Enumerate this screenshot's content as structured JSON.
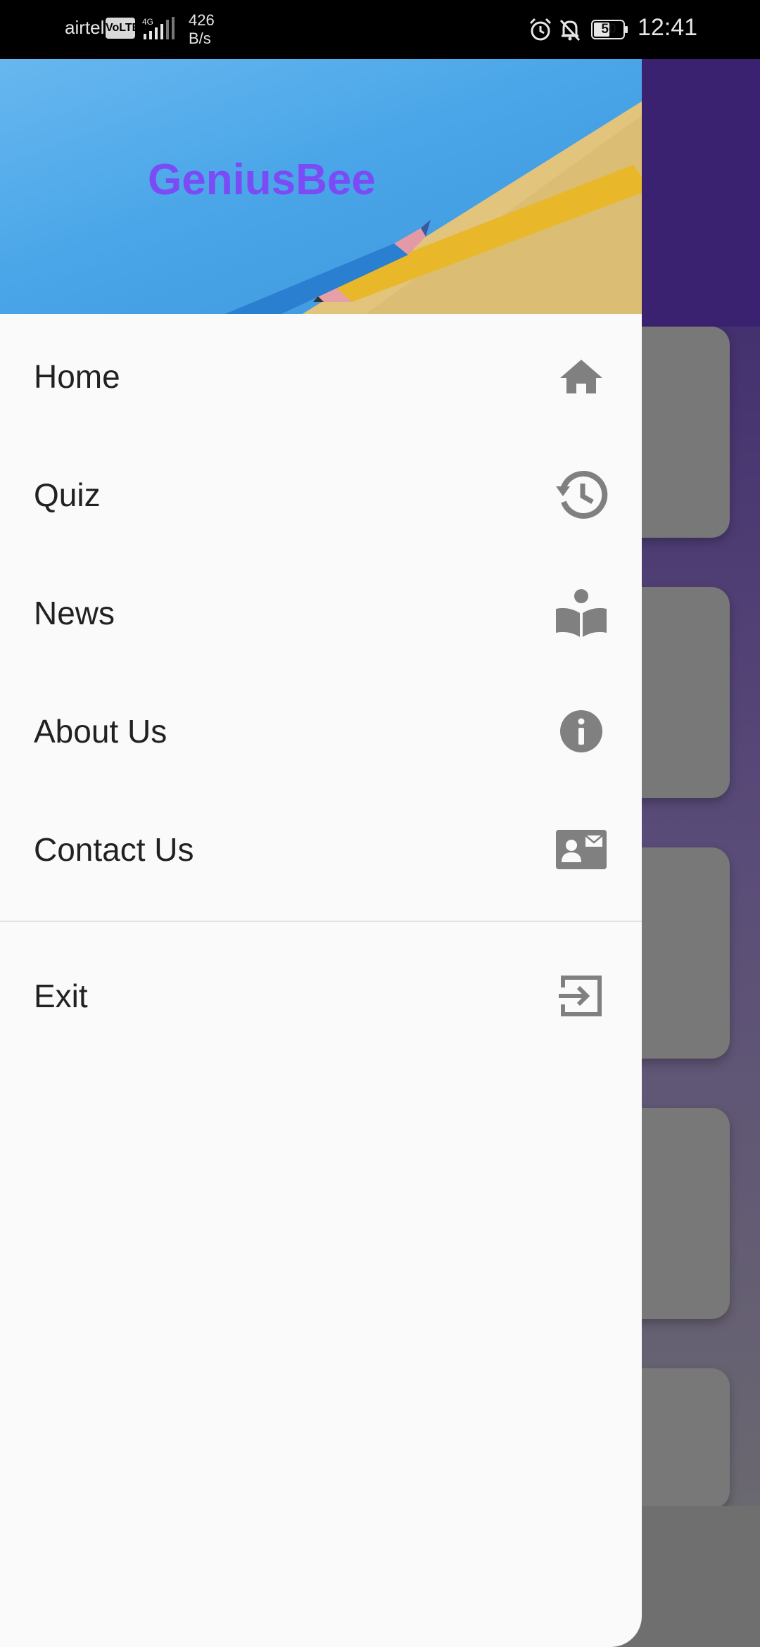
{
  "status_bar": {
    "carrier": "airtel",
    "volte_badge": "VoLTE",
    "network_type": "4G",
    "speed_value": "426",
    "speed_unit": "B/s",
    "battery_level": "50",
    "time": "12:41",
    "icons": [
      "signal-icon",
      "alarm-icon",
      "bell-off-icon",
      "battery-icon"
    ]
  },
  "drawer": {
    "title": "GeniusBee",
    "title_color": "#7b4cf5",
    "menu": [
      {
        "label": "Home",
        "icon": "home-icon"
      },
      {
        "label": "Quiz",
        "icon": "history-icon"
      },
      {
        "label": "News",
        "icon": "reading-icon"
      },
      {
        "label": "About Us",
        "icon": "info-icon"
      },
      {
        "label": "Contact Us",
        "icon": "contact-card-icon"
      }
    ],
    "footer_menu": [
      {
        "label": "Exit",
        "icon": "exit-icon"
      }
    ],
    "icon_color": "#808080"
  },
  "colors": {
    "app_header": "#3b2270",
    "drawer_background": "#fafafa",
    "status_bar": "#000000"
  }
}
